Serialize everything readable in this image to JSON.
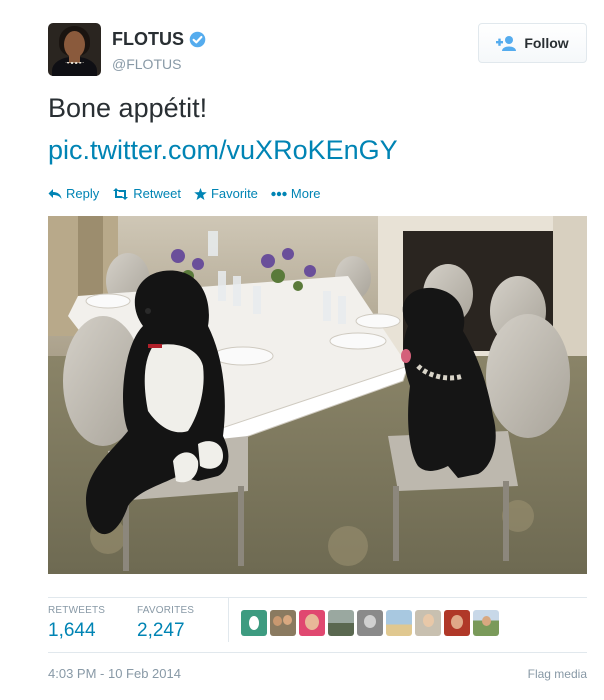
{
  "user": {
    "fullname": "FLOTUS",
    "handle": "@FLOTUS",
    "verified": true
  },
  "follow_label": "Follow",
  "tweet": {
    "text": "Bone appétit!",
    "link": "pic.twitter.com/vuXRoKEnGY"
  },
  "actions": {
    "reply": "Reply",
    "retweet": "Retweet",
    "favorite": "Favorite",
    "more": "More"
  },
  "stats": {
    "retweets_label": "RETWEETS",
    "retweets_value": "1,644",
    "favorites_label": "FAVORITES",
    "favorites_value": "2,247"
  },
  "favoriter_avatars": [
    "egg-avatar",
    "couple-avatar",
    "woman-avatar",
    "landscape-avatar",
    "bw-avatar",
    "beach-avatar",
    "portrait-avatar",
    "red-avatar",
    "outdoor-avatar"
  ],
  "timestamp": "4:03 PM - 10 Feb 2014",
  "flag_media": "Flag media",
  "colors": {
    "link": "#0084b4",
    "text": "#292f33",
    "muted": "#8899a6",
    "verified": "#55acee",
    "border": "#e1e8ed"
  }
}
